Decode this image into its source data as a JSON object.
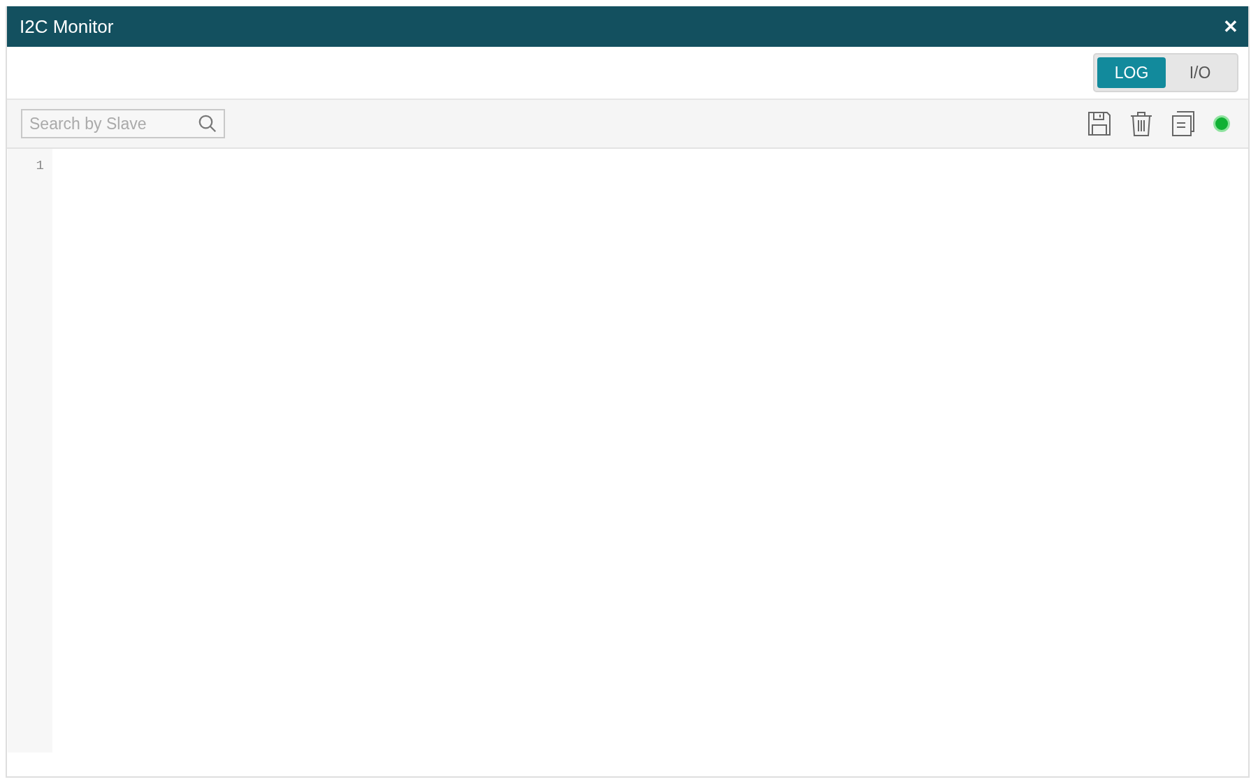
{
  "window": {
    "title": "I2C Monitor",
    "close": "✕"
  },
  "tabs": [
    {
      "label": "LOG",
      "selected": true
    },
    {
      "label": "I/O",
      "selected": false
    }
  ],
  "search": {
    "placeholder": "Search by Slave"
  },
  "monitor": {
    "on": true
  },
  "editor": {
    "line_numbers": [
      "1"
    ]
  }
}
